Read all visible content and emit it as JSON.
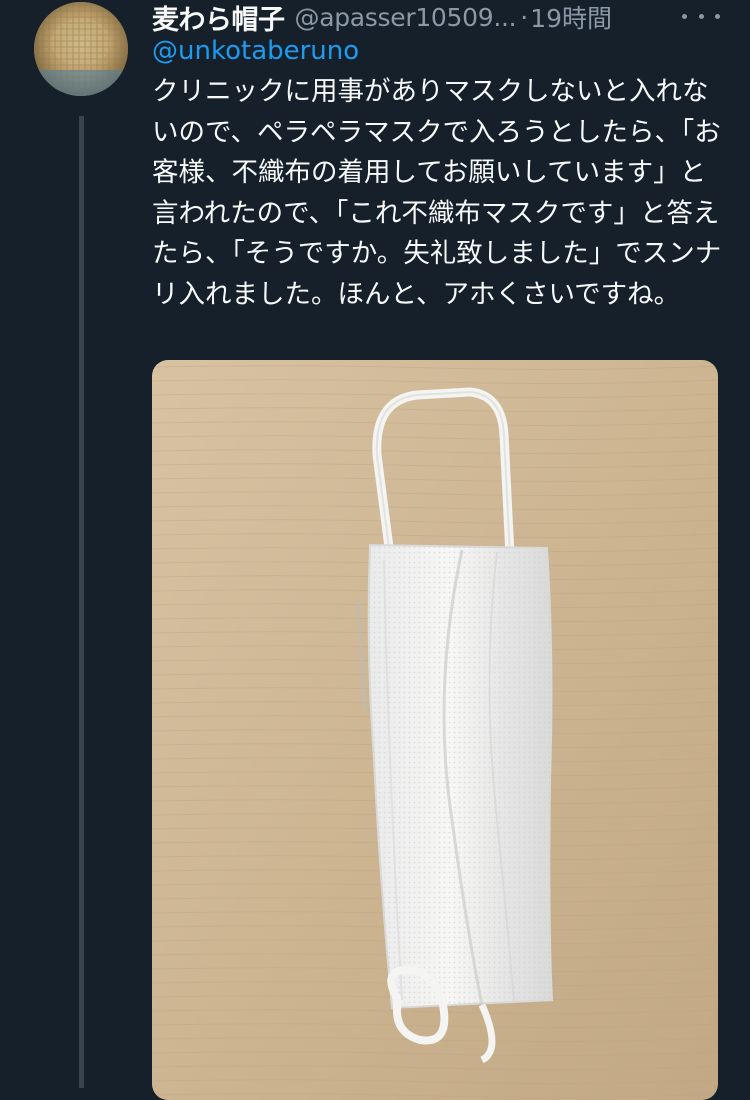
{
  "tweet": {
    "display_name": "麦わら帽子",
    "handle": "@apasser10509...",
    "separator": "·",
    "time": "19時間",
    "reply_to": "@unkotaberuno",
    "body": "クリニックに用事がありマスクしないと入れないので、ペラペラマスクで入ろうとしたら、「お客様、不織布の着用してお願いしています」と言われたので、「これ不織布マスクです」と答えたら、「そうですか。失礼致しました」でスンナリ入れました。ほんと、アホくさいですね。",
    "avatar_icon": "straw-hat-avatar",
    "more_icon": "more-options-icon",
    "media_alt": "white disposable mask on wooden table"
  },
  "colors": {
    "background": "#15202b",
    "primary_text": "#f7f9f9",
    "secondary_text": "#8b98a5",
    "link": "#1d9bf0",
    "thread_line": "#38444d"
  }
}
